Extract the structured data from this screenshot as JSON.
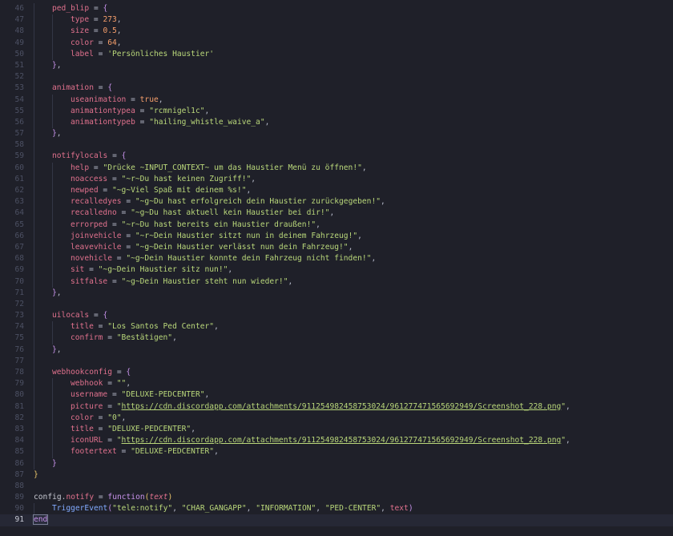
{
  "editor": {
    "active_line": 91,
    "lines": [
      {
        "num": "46",
        "indent": 1,
        "tokens": [
          [
            "var",
            "ped_blip"
          ],
          [
            "op",
            " = "
          ],
          [
            "brace2",
            "{"
          ]
        ]
      },
      {
        "num": "47",
        "indent": 2,
        "tokens": [
          [
            "var",
            "type"
          ],
          [
            "op",
            " = "
          ],
          [
            "num",
            "273"
          ],
          [
            "punc",
            ","
          ]
        ]
      },
      {
        "num": "48",
        "indent": 2,
        "tokens": [
          [
            "var",
            "size"
          ],
          [
            "op",
            " = "
          ],
          [
            "num",
            "0.5"
          ],
          [
            "punc",
            ","
          ]
        ]
      },
      {
        "num": "49",
        "indent": 2,
        "tokens": [
          [
            "var",
            "color"
          ],
          [
            "op",
            " = "
          ],
          [
            "num",
            "64"
          ],
          [
            "punc",
            ","
          ]
        ]
      },
      {
        "num": "50",
        "indent": 2,
        "tokens": [
          [
            "var",
            "label"
          ],
          [
            "op",
            " = "
          ],
          [
            "str",
            "'Persönliches Haustier'"
          ]
        ]
      },
      {
        "num": "51",
        "indent": 1,
        "tokens": [
          [
            "brace2",
            "}"
          ],
          [
            "punc",
            ","
          ]
        ]
      },
      {
        "num": "52",
        "indent": 1,
        "tokens": []
      },
      {
        "num": "53",
        "indent": 1,
        "tokens": [
          [
            "var",
            "animation"
          ],
          [
            "op",
            " = "
          ],
          [
            "brace2",
            "{"
          ]
        ]
      },
      {
        "num": "54",
        "indent": 2,
        "tokens": [
          [
            "var",
            "useanimation"
          ],
          [
            "op",
            " = "
          ],
          [
            "bool",
            "true"
          ],
          [
            "punc",
            ","
          ]
        ]
      },
      {
        "num": "55",
        "indent": 2,
        "tokens": [
          [
            "var",
            "animationtypea"
          ],
          [
            "op",
            " = "
          ],
          [
            "str",
            "\"rcmnigel1c\""
          ],
          [
            "punc",
            ","
          ]
        ]
      },
      {
        "num": "56",
        "indent": 2,
        "tokens": [
          [
            "var",
            "animationtypeb"
          ],
          [
            "op",
            " = "
          ],
          [
            "str",
            "\"hailing_whistle_waive_a\""
          ],
          [
            "punc",
            ","
          ]
        ]
      },
      {
        "num": "57",
        "indent": 1,
        "tokens": [
          [
            "brace2",
            "}"
          ],
          [
            "punc",
            ","
          ]
        ]
      },
      {
        "num": "58",
        "indent": 1,
        "tokens": []
      },
      {
        "num": "59",
        "indent": 1,
        "tokens": [
          [
            "var",
            "notifylocals"
          ],
          [
            "op",
            " = "
          ],
          [
            "brace2",
            "{"
          ]
        ]
      },
      {
        "num": "60",
        "indent": 2,
        "tokens": [
          [
            "var",
            "help"
          ],
          [
            "op",
            " = "
          ],
          [
            "str",
            "\"Drücke ~INPUT_CONTEXT~ um das Haustier Menü zu öffnen!\""
          ],
          [
            "punc",
            ","
          ]
        ]
      },
      {
        "num": "61",
        "indent": 2,
        "tokens": [
          [
            "var",
            "noaccess"
          ],
          [
            "op",
            " = "
          ],
          [
            "str",
            "\"~r~Du hast keinen Zugriff!\""
          ],
          [
            "punc",
            ","
          ]
        ]
      },
      {
        "num": "62",
        "indent": 2,
        "tokens": [
          [
            "var",
            "newped"
          ],
          [
            "op",
            " = "
          ],
          [
            "str",
            "\"~g~Viel Spaß mit deinem %s!\""
          ],
          [
            "punc",
            ","
          ]
        ]
      },
      {
        "num": "63",
        "indent": 2,
        "tokens": [
          [
            "var",
            "recalledyes"
          ],
          [
            "op",
            " = "
          ],
          [
            "str",
            "\"~g~Du hast erfolgreich dein Haustier zurückgegeben!\""
          ],
          [
            "punc",
            ","
          ]
        ]
      },
      {
        "num": "64",
        "indent": 2,
        "tokens": [
          [
            "var",
            "recalledno"
          ],
          [
            "op",
            " = "
          ],
          [
            "str",
            "\"~g~Du hast aktuell kein Haustier bei dir!\""
          ],
          [
            "punc",
            ","
          ]
        ]
      },
      {
        "num": "65",
        "indent": 2,
        "tokens": [
          [
            "var",
            "errorped"
          ],
          [
            "op",
            " = "
          ],
          [
            "str",
            "\"~r~Du hast bereits ein Haustier draußen!\""
          ],
          [
            "punc",
            ","
          ]
        ]
      },
      {
        "num": "66",
        "indent": 2,
        "tokens": [
          [
            "var",
            "joinvehicle"
          ],
          [
            "op",
            " = "
          ],
          [
            "str",
            "\"~r~Dein Haustier sitzt nun in deinem Fahrzeug!\""
          ],
          [
            "punc",
            ","
          ]
        ]
      },
      {
        "num": "67",
        "indent": 2,
        "tokens": [
          [
            "var",
            "leavevhicle"
          ],
          [
            "op",
            " = "
          ],
          [
            "str",
            "\"~g~Dein Haustier verlässt nun dein Fahrzeug!\""
          ],
          [
            "punc",
            ","
          ]
        ]
      },
      {
        "num": "68",
        "indent": 2,
        "tokens": [
          [
            "var",
            "novehicle"
          ],
          [
            "op",
            " = "
          ],
          [
            "str",
            "\"~g~Dein Haustier konnte dein Fahrzeug nicht finden!\""
          ],
          [
            "punc",
            ","
          ]
        ]
      },
      {
        "num": "69",
        "indent": 2,
        "tokens": [
          [
            "var",
            "sit"
          ],
          [
            "op",
            " = "
          ],
          [
            "str",
            "\"~g~Dein Haustier sitz nun!\""
          ],
          [
            "punc",
            ","
          ]
        ]
      },
      {
        "num": "70",
        "indent": 2,
        "tokens": [
          [
            "var",
            "sitfalse"
          ],
          [
            "op",
            " = "
          ],
          [
            "str",
            "\"~g~Dein Haustier steht nun wieder!\""
          ],
          [
            "punc",
            ","
          ]
        ]
      },
      {
        "num": "71",
        "indent": 1,
        "tokens": [
          [
            "brace2",
            "}"
          ],
          [
            "punc",
            ","
          ]
        ]
      },
      {
        "num": "72",
        "indent": 1,
        "tokens": []
      },
      {
        "num": "73",
        "indent": 1,
        "tokens": [
          [
            "var",
            "uilocals"
          ],
          [
            "op",
            " = "
          ],
          [
            "brace2",
            "{"
          ]
        ]
      },
      {
        "num": "74",
        "indent": 2,
        "tokens": [
          [
            "var",
            "title"
          ],
          [
            "op",
            " = "
          ],
          [
            "str",
            "\"Los Santos Ped Center\""
          ],
          [
            "punc",
            ","
          ]
        ]
      },
      {
        "num": "75",
        "indent": 2,
        "tokens": [
          [
            "var",
            "confirm"
          ],
          [
            "op",
            " = "
          ],
          [
            "str",
            "\"Bestätigen\""
          ],
          [
            "punc",
            ","
          ]
        ]
      },
      {
        "num": "76",
        "indent": 1,
        "tokens": [
          [
            "brace2",
            "}"
          ],
          [
            "punc",
            ","
          ]
        ]
      },
      {
        "num": "77",
        "indent": 1,
        "tokens": []
      },
      {
        "num": "78",
        "indent": 1,
        "tokens": [
          [
            "var",
            "webhookconfig"
          ],
          [
            "op",
            " = "
          ],
          [
            "brace2",
            "{"
          ]
        ]
      },
      {
        "num": "79",
        "indent": 2,
        "tokens": [
          [
            "var",
            "webhook"
          ],
          [
            "op",
            " = "
          ],
          [
            "str",
            "\"\""
          ],
          [
            "punc",
            ","
          ]
        ]
      },
      {
        "num": "80",
        "indent": 2,
        "tokens": [
          [
            "var",
            "username"
          ],
          [
            "op",
            " = "
          ],
          [
            "str",
            "\"DELUXE-PEDCENTER\""
          ],
          [
            "punc",
            ","
          ]
        ]
      },
      {
        "num": "81",
        "indent": 2,
        "tokens": [
          [
            "var",
            "picture"
          ],
          [
            "op",
            " = "
          ],
          [
            "str",
            "\""
          ],
          [
            "url",
            "https://cdn.discordapp.com/attachments/911254982458753024/961277471565692949/Screenshot_228.png"
          ],
          [
            "str",
            "\""
          ],
          [
            "punc",
            ","
          ]
        ]
      },
      {
        "num": "82",
        "indent": 2,
        "tokens": [
          [
            "var",
            "color"
          ],
          [
            "op",
            " = "
          ],
          [
            "str",
            "\"0\""
          ],
          [
            "punc",
            ","
          ]
        ]
      },
      {
        "num": "83",
        "indent": 2,
        "tokens": [
          [
            "var",
            "title"
          ],
          [
            "op",
            " = "
          ],
          [
            "str",
            "\"DELUXE-PEDCENTER\""
          ],
          [
            "punc",
            ","
          ]
        ]
      },
      {
        "num": "84",
        "indent": 2,
        "tokens": [
          [
            "var",
            "iconURL"
          ],
          [
            "op",
            " = "
          ],
          [
            "str",
            "\""
          ],
          [
            "url",
            "https://cdn.discordapp.com/attachments/911254982458753024/961277471565692949/Screenshot_228.png"
          ],
          [
            "str",
            "\""
          ],
          [
            "punc",
            ","
          ]
        ]
      },
      {
        "num": "85",
        "indent": 2,
        "tokens": [
          [
            "var",
            "footertext"
          ],
          [
            "op",
            " = "
          ],
          [
            "str",
            "\"DELUXE-PEDCENTER\""
          ],
          [
            "punc",
            ","
          ]
        ]
      },
      {
        "num": "86",
        "indent": 1,
        "tokens": [
          [
            "brace2",
            "}"
          ]
        ]
      },
      {
        "num": "87",
        "indent": 0,
        "tokens": [
          [
            "brace1",
            "}"
          ]
        ]
      },
      {
        "num": "88",
        "indent": 0,
        "tokens": []
      },
      {
        "num": "89",
        "indent": 0,
        "tokens": [
          [
            "plain",
            "config"
          ],
          [
            "punc",
            "."
          ],
          [
            "var",
            "notify"
          ],
          [
            "op",
            " = "
          ],
          [
            "kw",
            "function"
          ],
          [
            "brace1",
            "("
          ],
          [
            "param",
            "text"
          ],
          [
            "brace1",
            ")"
          ]
        ]
      },
      {
        "num": "90",
        "indent": 1,
        "tokens": [
          [
            "fn",
            "TriggerEvent"
          ],
          [
            "brace2",
            "("
          ],
          [
            "str",
            "\"tele:notify\""
          ],
          [
            "punc",
            ", "
          ],
          [
            "str",
            "\"CHAR_GANGAPP\""
          ],
          [
            "punc",
            ", "
          ],
          [
            "str",
            "\"INFORMATION\""
          ],
          [
            "punc",
            ", "
          ],
          [
            "str",
            "\"PED-CENTER\""
          ],
          [
            "punc",
            ", "
          ],
          [
            "var",
            "text"
          ],
          [
            "brace2",
            ")"
          ]
        ]
      },
      {
        "num": "91",
        "indent": 0,
        "tokens": [
          [
            "endbox",
            "end"
          ]
        ]
      }
    ]
  }
}
